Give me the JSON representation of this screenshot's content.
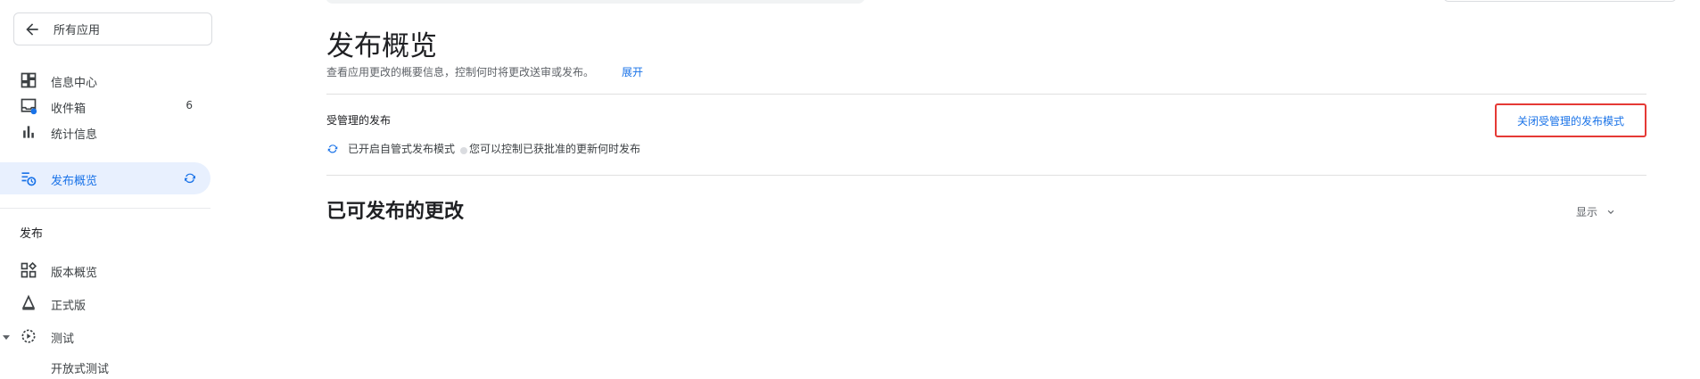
{
  "sidebar": {
    "back_label": "所有应用",
    "items": [
      {
        "label": "信息中心",
        "icon": "dashboard-icon"
      },
      {
        "label": "收件箱",
        "icon": "inbox-icon",
        "badge": "6"
      },
      {
        "label": "统计信息",
        "icon": "bar-chart-icon"
      },
      {
        "label": "发布概览",
        "icon": "publishing-overview-icon",
        "active": true
      }
    ],
    "section_title": "发布",
    "section_items": [
      {
        "label": "版本概览",
        "icon": "grid-icon"
      },
      {
        "label": "正式版",
        "icon": "production-icon"
      },
      {
        "label": "测试",
        "icon": "testing-icon"
      }
    ],
    "sub_item": "开放式测试"
  },
  "main": {
    "title": "发布概览",
    "subtitle": "查看应用更改的概要信息，控制何时将更改送审或发布。",
    "expand_link": "展开",
    "managed": {
      "title": "受管理的发布",
      "status": "已开启自管式发布模式",
      "description": "您可以控制已获批准的更新何时发布",
      "turn_off_button": "关闭受管理的发布模式"
    },
    "ready": {
      "title": "已可发布的更改",
      "show_toggle": "显示"
    }
  },
  "colors": {
    "accent": "#1a73e8",
    "highlight_border": "#e53935",
    "active_bg": "#e8f0fe"
  }
}
